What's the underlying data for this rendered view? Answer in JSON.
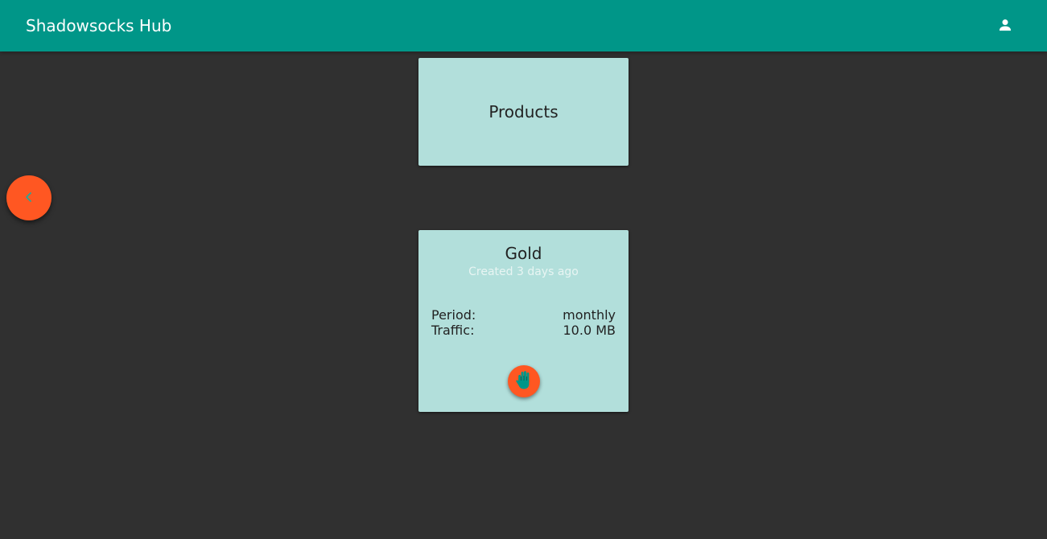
{
  "app_bar": {
    "title": "Shadowsocks Hub",
    "account_icon": "account-icon"
  },
  "products_card": {
    "title": "Products"
  },
  "back_button": {
    "icon": "chevron-left-icon"
  },
  "plan": {
    "name": "Gold",
    "created": "Created 3 days ago",
    "period_label": "Period:",
    "period_value": "monthly",
    "traffic_label": "Traffic:",
    "traffic_value": "10.0 MB",
    "action_icon": "hand-stop-icon"
  },
  "colors": {
    "primary": "#009688",
    "accent": "#ff5722",
    "card": "#b2dfdb",
    "background": "#303030"
  }
}
